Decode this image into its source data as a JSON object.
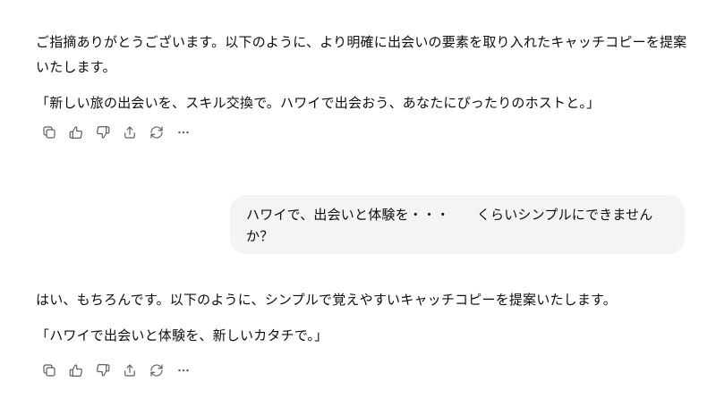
{
  "conversation": {
    "assistant_1": {
      "paragraph_1": "ご指摘ありがとうございます。以下のように、より明確に出会いの要素を取り入れたキャッチコピーを提案いたします。",
      "paragraph_2": "「新しい旅の出会いを、スキル交換で。ハワイで出会おう、あなたにぴったりのホストと。」"
    },
    "user_1": {
      "text": "ハワイで、出会いと体験を・・・　　くらいシンプルにできませんか？"
    },
    "assistant_2": {
      "paragraph_1": "はい、もちろんです。以下のように、シンプルで覚えやすいキャッチコピーを提案いたします。",
      "paragraph_2": "「ハワイで出会いと体験を、新しいカタチで。」"
    }
  },
  "toolbar_icons": [
    "copy-icon",
    "thumbs-up-icon",
    "thumbs-down-icon",
    "share-icon",
    "regenerate-icon",
    "more-icon"
  ],
  "colors": {
    "text": "#0d0d0d",
    "icon": "#5d5d5d",
    "user_bubble": "#f4f4f4"
  }
}
